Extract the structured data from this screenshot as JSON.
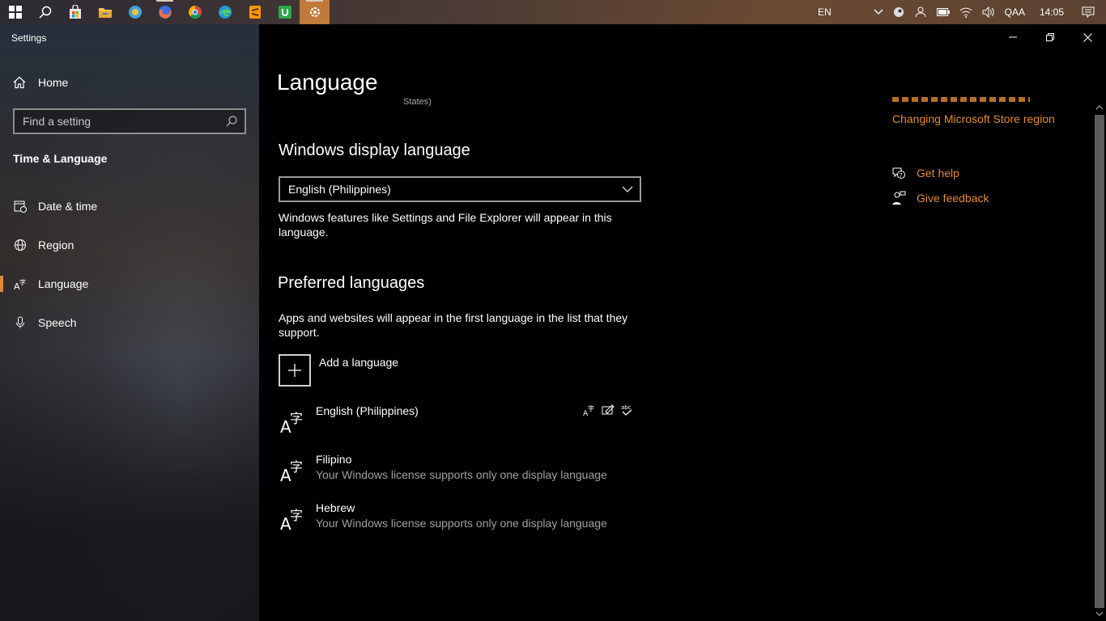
{
  "taskbar": {
    "icons": [
      "windows-start-icon",
      "search-icon",
      "store-icon",
      "file-explorer-icon",
      "globe-app-icon",
      "firefox-icon",
      "chrome-icon",
      "edge-icon",
      "sublime-text-icon",
      "green-app-icon",
      "settings-icon"
    ],
    "language": "EN",
    "user": "QAA",
    "time": "14:05"
  },
  "sidebar": {
    "app_title": "Settings",
    "home_label": "Home",
    "search_placeholder": "Find a setting",
    "section_title": "Time & Language",
    "items": [
      {
        "label": "Date & time",
        "icon": "calendar-clock-icon"
      },
      {
        "label": "Region",
        "icon": "globe-region-icon"
      },
      {
        "label": "Language",
        "icon": "language-icon",
        "selected": true
      },
      {
        "label": "Speech",
        "icon": "microphone-icon"
      }
    ]
  },
  "main": {
    "title": "Language",
    "clipped_text": "States)",
    "display_language": {
      "heading": "Windows display language",
      "selected": "English (Philippines)",
      "description": "Windows features like Settings and File Explorer will appear in this language."
    },
    "preferred": {
      "heading": "Preferred languages",
      "description": "Apps and websites will appear in the first language in the list that they support.",
      "add_label": "Add a language",
      "languages": [
        {
          "name": "English (Philippines)",
          "note": ""
        },
        {
          "name": "Filipino",
          "note": "Your Windows license supports only one display language"
        },
        {
          "name": "Hebrew",
          "note": "Your Windows license supports only one display language"
        }
      ]
    },
    "related": {
      "store_region_link": "Changing Microsoft Store region",
      "get_help": "Get help",
      "give_feedback": "Give feedback"
    }
  },
  "colors": {
    "accent": "#e38b34",
    "background": "#000000",
    "secondary_text": "#a0a0a0"
  }
}
